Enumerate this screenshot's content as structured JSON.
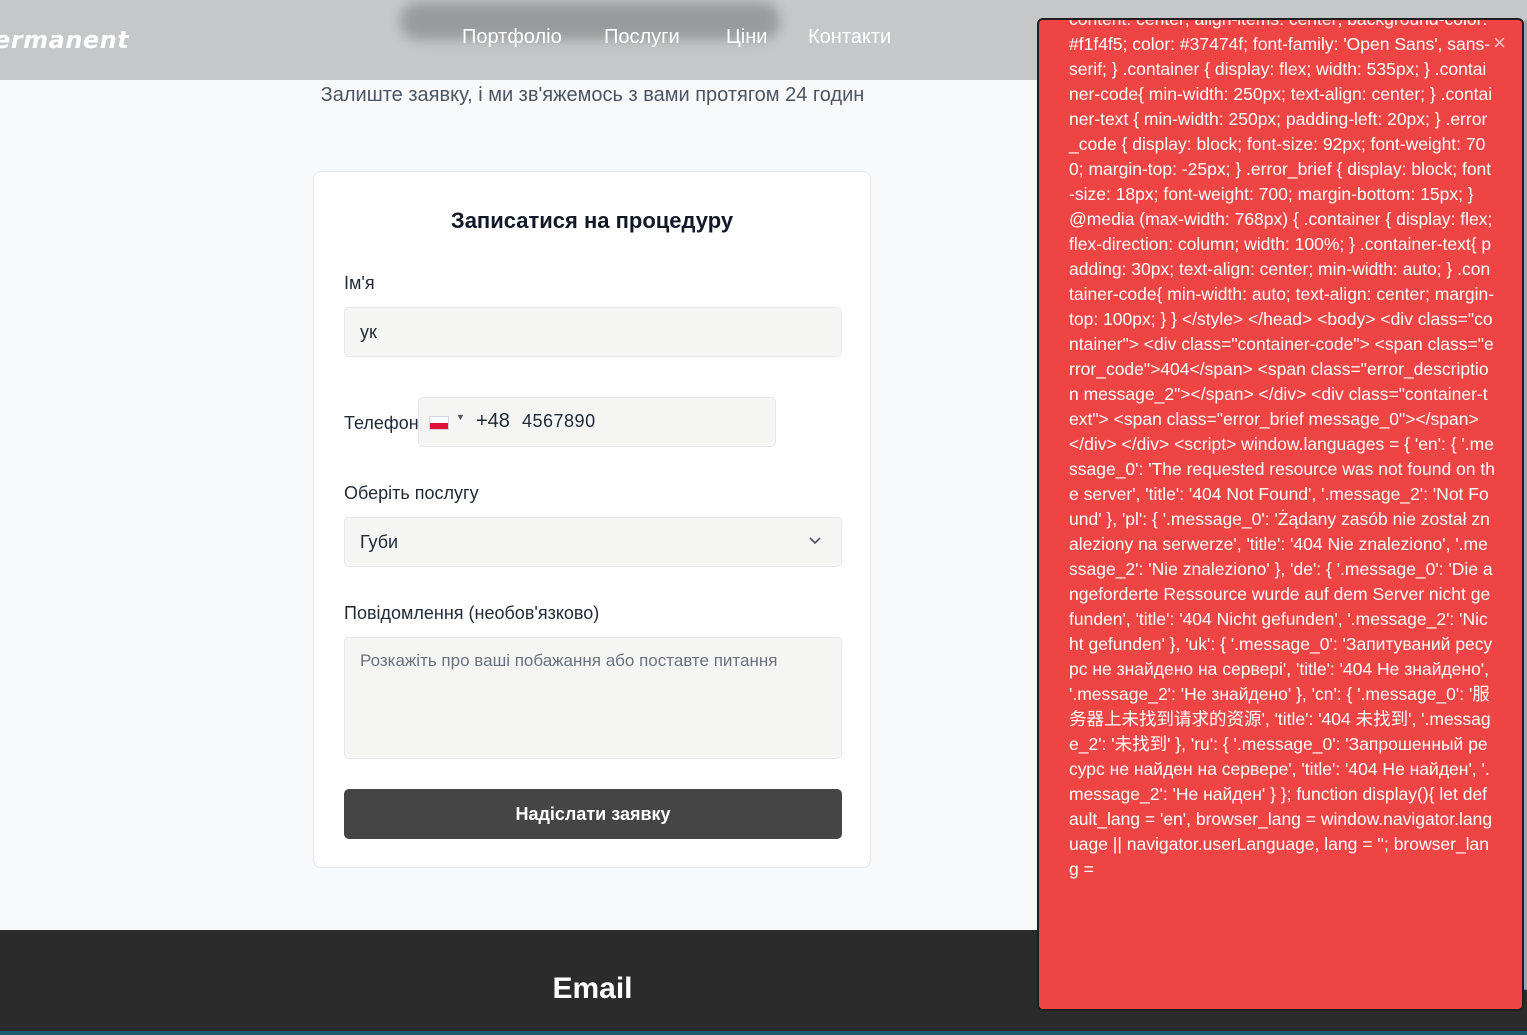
{
  "header": {
    "logo": "ermanent",
    "nav": [
      "Портфоліо",
      "Послуги",
      "Ціни",
      "Контакти"
    ]
  },
  "subtitle": "Залиште заявку, і ми зв'яжемось з вами протягом 24 годин",
  "form": {
    "title": "Записатися на процедуру",
    "name_label": "Ім'я",
    "name_value": "ук",
    "phone_label": "Телефон",
    "phone_country": "PL",
    "phone_dial_code": "+48",
    "phone_value": "4567890",
    "service_label": "Оберіть послугу",
    "service_value": "Губи",
    "message_label": "Повідомлення (необов'язково)",
    "message_placeholder": "Розкажіть про ваші побажання або поставте питання",
    "submit_label": "Надіслати заявку"
  },
  "footer": {
    "title": "Email"
  },
  "error_overlay": {
    "close_glyph": "×",
    "code_text": "content: center; align-items: center; background-color: #f1f4f5; color: #37474f; font-family: 'Open Sans', sans-serif; } .container { display: flex; width: 535px; } .container-code{ min-width: 250px; text-align: center; } .container-text { min-width: 250px; padding-left: 20px; } .error_code { display: block; font-size: 92px; font-weight: 700; margin-top: -25px; } .error_brief { display: block; font-size: 18px; font-weight: 700; margin-bottom: 15px; } @media (max-width: 768px) { .container { display: flex; flex-direction: column; width: 100%; } .container-text{ padding: 30px; text-align: center; min-width: auto; } .container-code{ min-width: auto; text-align: center; margin-top: 100px; } } </style> </head> <body> <div class=\"container\"> <div class=\"container-code\"> <span class=\"error_code\">404</span> <span class=\"error_description message_2\"></span> </div> <div class=\"container-text\"> <span class=\"error_brief message_0\"></span> </div> </div> <script> window.languages = { 'en': { '.message_0': 'The requested resource was not found on the server', 'title': '404 Not Found', '.message_2': 'Not Found' }, 'pl': { '.message_0': 'Żądany zasób nie został znaleziony na serwerze', 'title': '404 Nie znaleziono', '.message_2': 'Nie znaleziono' }, 'de': { '.message_0': 'Die angeforderte Ressource wurde auf dem Server nicht gefunden', 'title': '404 Nicht gefunden', '.message_2': 'Nicht gefunden' }, 'uk': { '.message_0': 'Запитуваний ресурс не знайдено на сервері', 'title': '404 Не знайдено', '.message_2': 'Не знайдено' }, 'cn': { '.message_0': '服务器上未找到请求的资源', 'title': '404 未找到', '.message_2': '未找到' }, 'ru': { '.message_0': 'Запрошенный ресурс не найден на сервере', 'title': '404 Не найден', '.message_2': 'Не найден' } }; function display(){ let default_lang = 'en', browser_lang = window.navigator.language || navigator.userLanguage, lang = ''; browser_lang ="
  },
  "colors": {
    "header_bg": "#c6c7c9",
    "overlay_bg": "#ef4444",
    "submit_bg": "#454545",
    "footer_bg": "#2b2b2b"
  }
}
